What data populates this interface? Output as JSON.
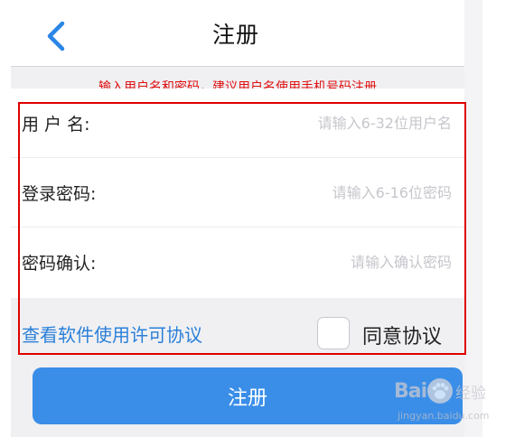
{
  "nav": {
    "title": "注册",
    "back_icon": "chevron-left-icon"
  },
  "hint": "输入用户名和密码，建议用户名使用手机号码注册",
  "fields": [
    {
      "label": "用 户  名:",
      "placeholder": "请输入6-32位用户名",
      "value": ""
    },
    {
      "label": "登录密码:",
      "placeholder": "请输入6-16位密码",
      "value": ""
    },
    {
      "label": "密码确认:",
      "placeholder": "请输入确认密码",
      "value": ""
    }
  ],
  "license_link": "查看软件使用许可协议",
  "agree": {
    "label": "同意协议",
    "checked": false
  },
  "register_button": "注册",
  "watermark": {
    "brand": "Bai",
    "suffix": "经验",
    "url": "jingyan.baidu.com"
  },
  "colors": {
    "accent": "#3a8ee8",
    "link": "#2a80d8",
    "hint": "#e01010",
    "annotation_frame": "#e00000",
    "background": "#f0f0f3"
  }
}
